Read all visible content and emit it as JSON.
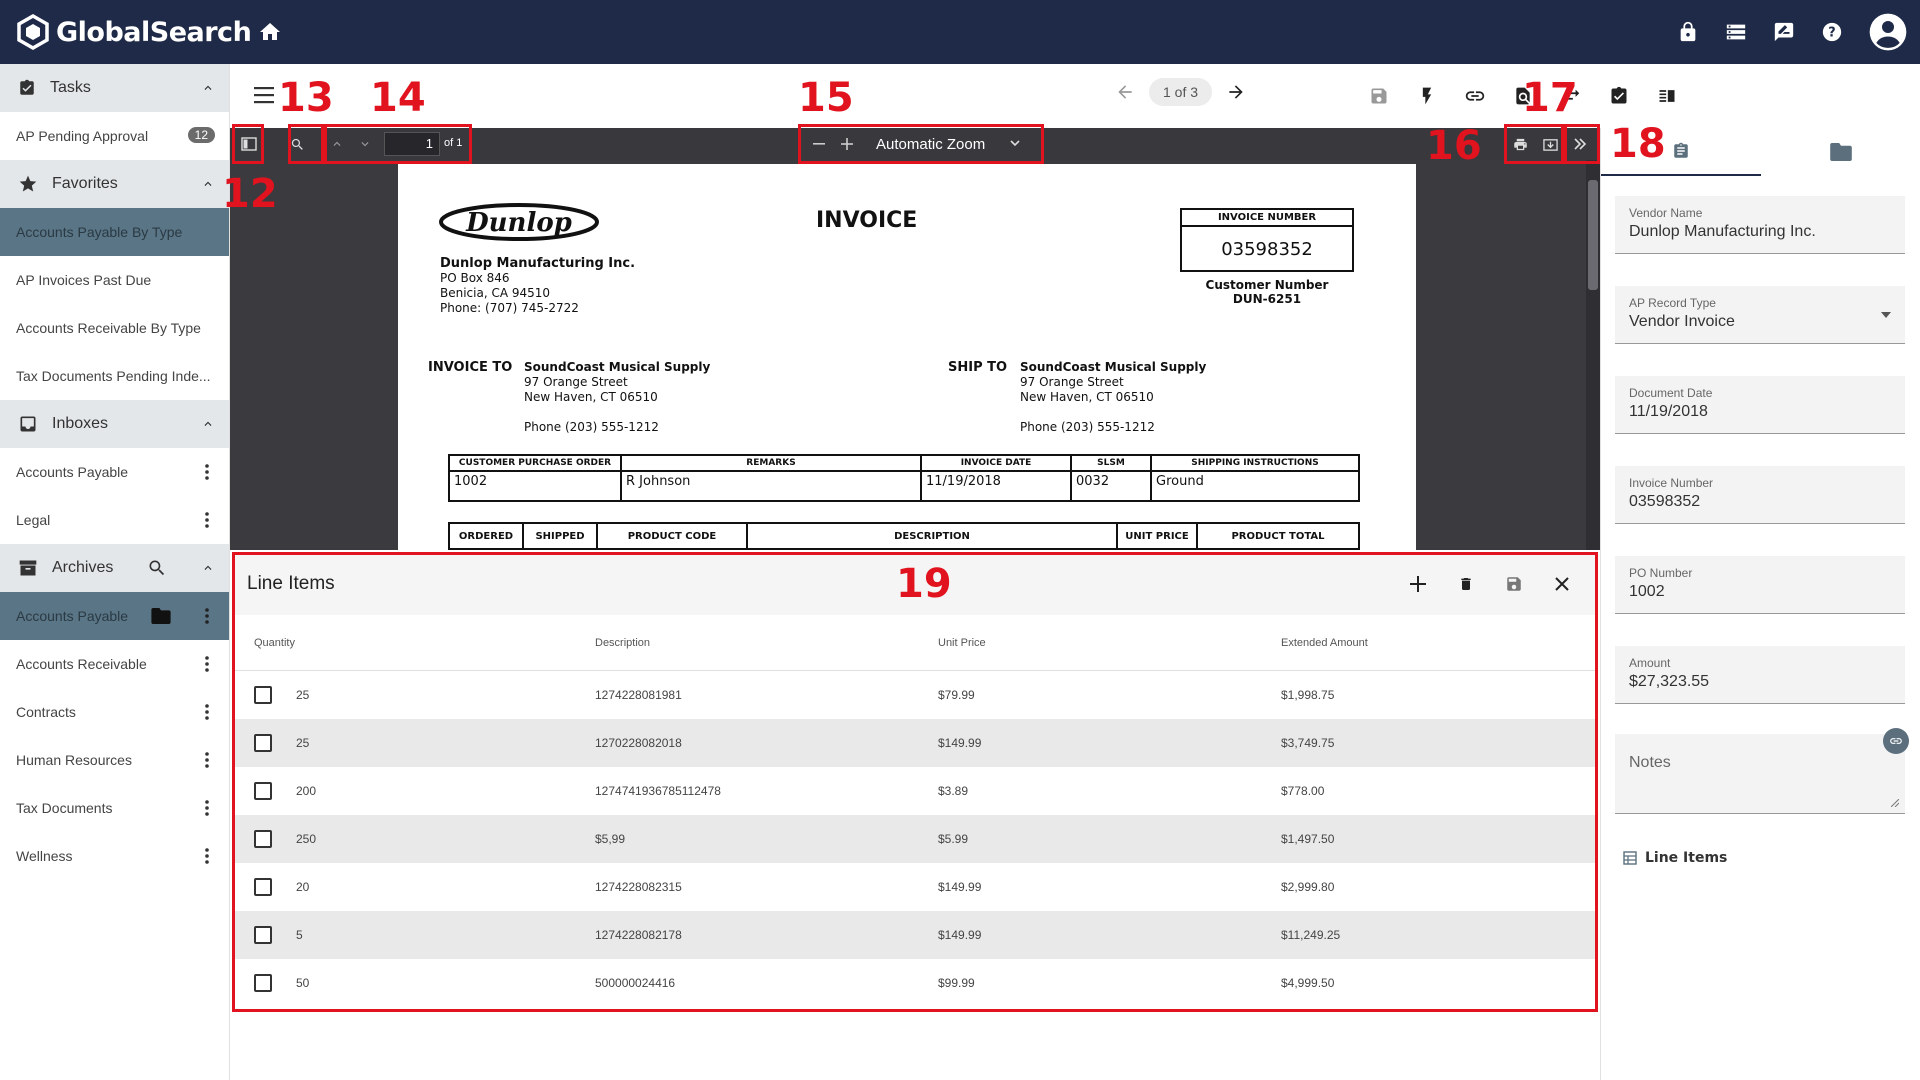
{
  "app": {
    "name": "GlobalSearch"
  },
  "sidebar": {
    "tasks": {
      "label": "Tasks",
      "items": [
        {
          "label": "AP Pending Approval",
          "badge": "12"
        }
      ]
    },
    "favorites": {
      "label": "Favorites",
      "items": [
        {
          "label": "Accounts Payable By Type"
        },
        {
          "label": "AP Invoices Past Due"
        },
        {
          "label": "Accounts Receivable By Type"
        },
        {
          "label": "Tax Documents Pending Inde..."
        }
      ]
    },
    "inboxes": {
      "label": "Inboxes",
      "items": [
        {
          "label": "Accounts Payable"
        },
        {
          "label": "Legal"
        }
      ]
    },
    "archives": {
      "label": "Archives",
      "items": [
        {
          "label": "Accounts Payable"
        },
        {
          "label": "Accounts Receivable"
        },
        {
          "label": "Contracts"
        },
        {
          "label": "Human Resources"
        },
        {
          "label": "Tax Documents"
        },
        {
          "label": "Wellness"
        }
      ]
    }
  },
  "viewer": {
    "pager": "1 of 3",
    "page_input": "1",
    "page_of": "of 1",
    "zoom": "Automatic Zoom"
  },
  "annotations": {
    "n12": "12",
    "n13": "13",
    "n14": "14",
    "n15": "15",
    "n16": "16",
    "n17": "17",
    "n18": "18",
    "n19": "19"
  },
  "invoice": {
    "title": "INVOICE",
    "vendor": "Dunlop Manufacturing Inc.",
    "vendor_addr1": "PO Box 846",
    "vendor_addr2": "Benicia, CA 94510",
    "vendor_phone": "Phone: (707) 745-2722",
    "num_label": "INVOICE NUMBER",
    "num_value": "03598352",
    "cust_label": "Customer Number",
    "cust_value": "DUN-6251",
    "invoice_to_label": "INVOICE TO",
    "ship_to_label": "SHIP TO",
    "to_name": "SoundCoast Musical Supply",
    "to_addr1": "97 Orange Street",
    "to_addr2": "New Haven, CT 06510",
    "to_phone": "Phone (203) 555-1212",
    "table_headers": [
      "CUSTOMER PURCHASE ORDER",
      "REMARKS",
      "INVOICE DATE",
      "SLSM",
      "SHIPPING INSTRUCTIONS"
    ],
    "table_values": [
      "1002",
      "R  Johnson",
      "11/19/2018",
      "0032",
      "Ground"
    ],
    "table_headers2": [
      "ORDERED",
      "SHIPPED",
      "PRODUCT CODE",
      "DESCRIPTION",
      "UNIT PRICE",
      "PRODUCT TOTAL"
    ]
  },
  "line_items": {
    "title": "Line Items",
    "columns": [
      "Quantity",
      "Description",
      "Unit Price",
      "Extended Amount"
    ],
    "rows": [
      {
        "qty": "25",
        "desc": "1274228081981",
        "price": "$79.99",
        "amount": "$1,998.75"
      },
      {
        "qty": "25",
        "desc": "1270228082018",
        "price": "$149.99",
        "amount": "$3,749.75"
      },
      {
        "qty": "200",
        "desc": "1274741936785112478",
        "price": "$3.89",
        "amount": "$778.00"
      },
      {
        "qty": "250",
        "desc": "$5,99",
        "price": "$5.99",
        "amount": "$1,497.50"
      },
      {
        "qty": "20",
        "desc": "1274228082315",
        "price": "$149.99",
        "amount": "$2,999.80"
      },
      {
        "qty": "5",
        "desc": "1274228082178",
        "price": "$149.99",
        "amount": "$11,249.25"
      },
      {
        "qty": "50",
        "desc": "500000024416",
        "price": "$99.99",
        "amount": "$4,999.50"
      }
    ]
  },
  "metadata": {
    "fields": [
      {
        "label": "Vendor Name",
        "value": "Dunlop Manufacturing Inc."
      },
      {
        "label": "AP Record Type",
        "value": "Vendor Invoice"
      },
      {
        "label": "Document Date",
        "value": "11/19/2018"
      },
      {
        "label": "Invoice Number",
        "value": "03598352"
      },
      {
        "label": "PO Number",
        "value": "1002"
      },
      {
        "label": "Amount",
        "value": "$27,323.55"
      }
    ],
    "notes_label": "Notes",
    "line_items_link": "Line Items"
  }
}
